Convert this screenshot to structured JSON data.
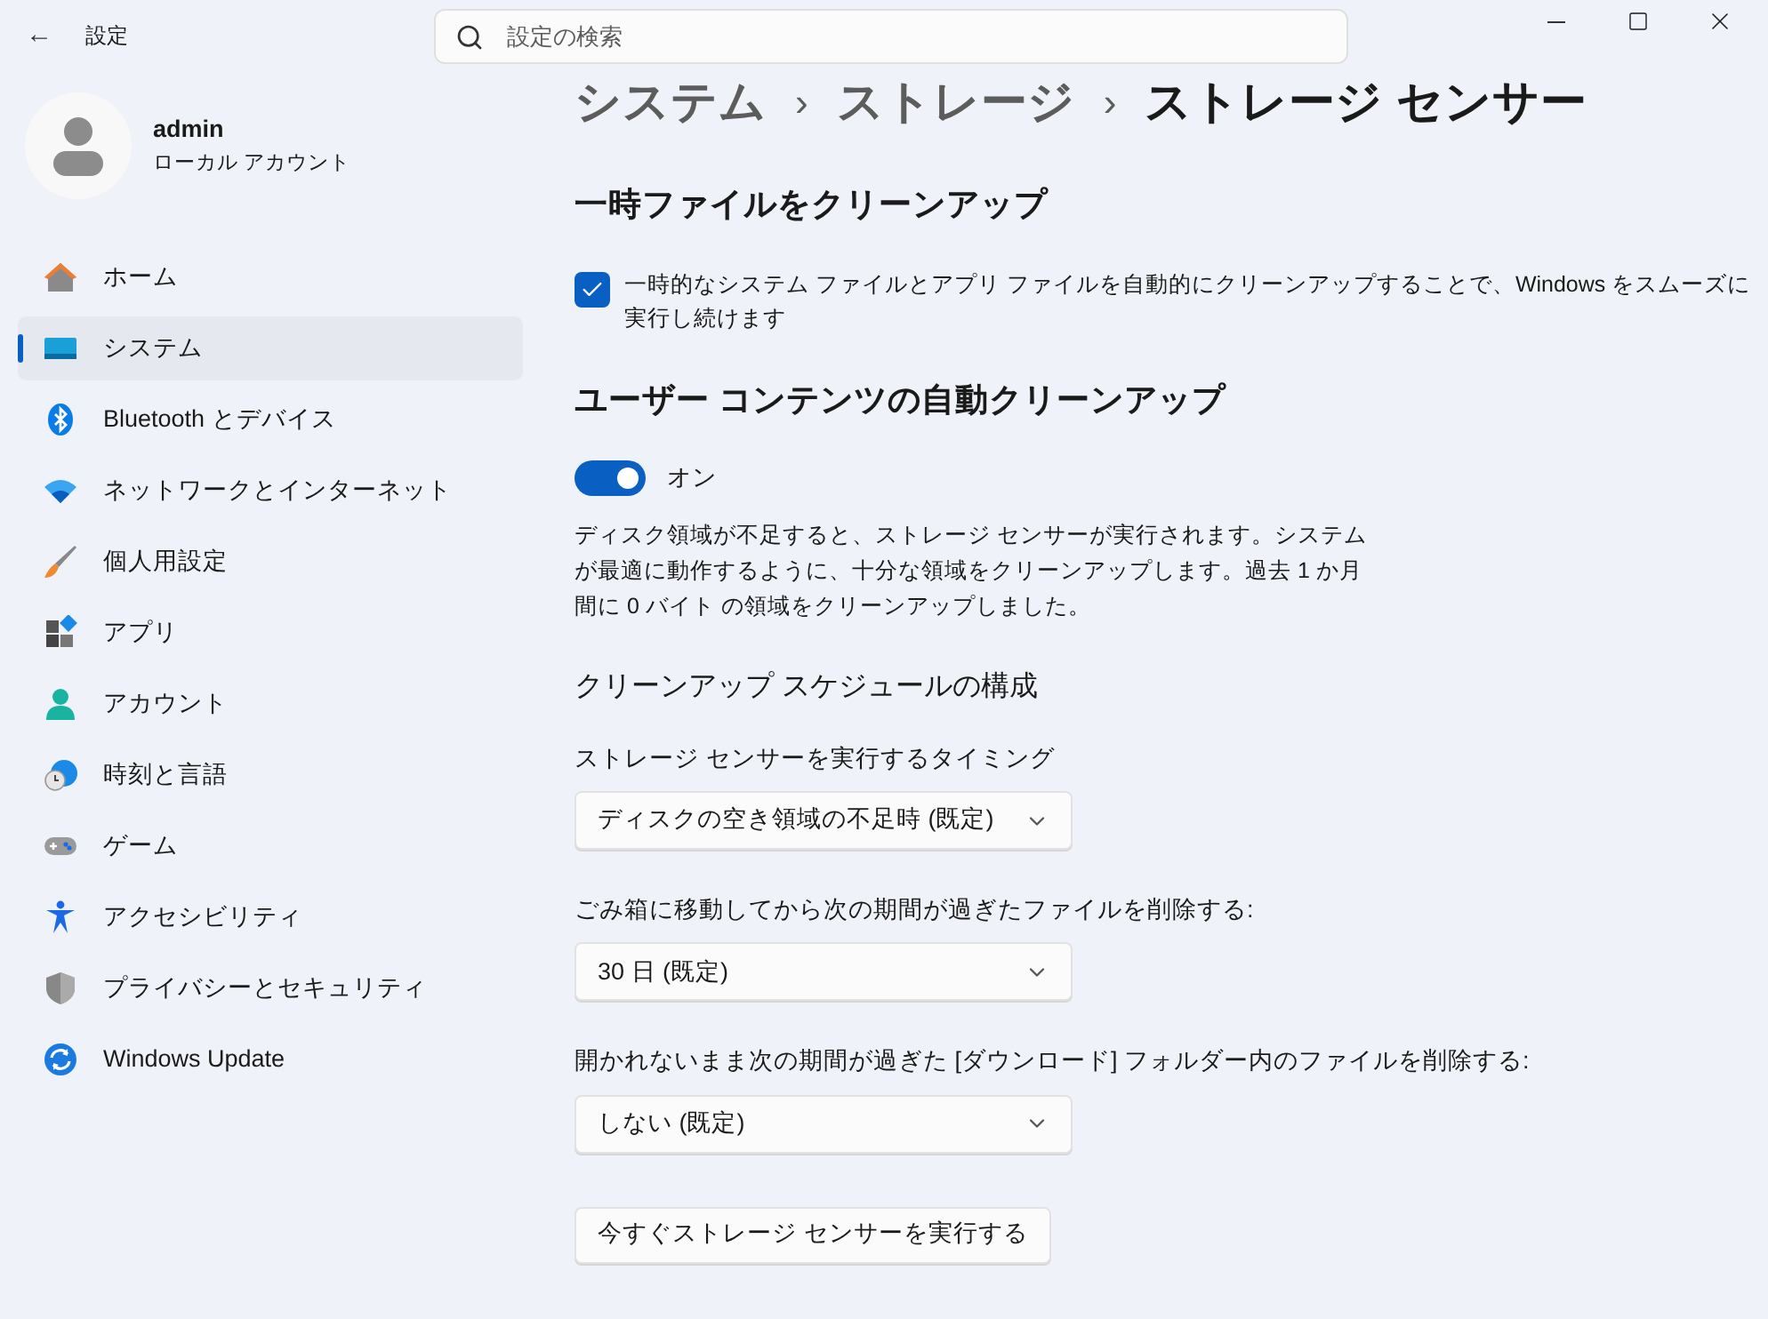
{
  "window": {
    "title": "設定",
    "back": "←"
  },
  "search": {
    "placeholder": "設定の検索"
  },
  "user": {
    "name": "admin",
    "account": "ローカル アカウント"
  },
  "sidebar": {
    "items": [
      {
        "label": "ホーム",
        "selected": false
      },
      {
        "label": "システム",
        "selected": true
      },
      {
        "label": "Bluetooth とデバイス",
        "selected": false
      },
      {
        "label": "ネットワークとインターネット",
        "selected": false
      },
      {
        "label": "個人用設定",
        "selected": false
      },
      {
        "label": "アプリ",
        "selected": false
      },
      {
        "label": "アカウント",
        "selected": false
      },
      {
        "label": "時刻と言語",
        "selected": false
      },
      {
        "label": "ゲーム",
        "selected": false
      },
      {
        "label": "アクセシビリティ",
        "selected": false
      },
      {
        "label": "プライバシーとセキュリティ",
        "selected": false
      },
      {
        "label": "Windows Update",
        "selected": false
      }
    ]
  },
  "breadcrumb": [
    "システム",
    "ストレージ",
    "ストレージ センサー"
  ],
  "breadcrumb_separator": "›",
  "temp_files": {
    "heading": "一時ファイルをクリーンアップ",
    "checkbox": {
      "label": "一時的なシステム ファイルとアプリ ファイルを自動的にクリーンアップすることで、Windows をスムーズに実行し続けます",
      "checked": true
    }
  },
  "auto_cleanup": {
    "heading": "ユーザー コンテンツの自動クリーンアップ",
    "toggle": {
      "on": true,
      "label": "オン"
    },
    "description": "ディスク領域が不足すると、ストレージ センサーが実行されます。システムが最適に動作するように、十分な領域をクリーンアップします。過去 1 か月間に 0 バイト の領域をクリーンアップしました。"
  },
  "schedule": {
    "heading": "クリーンアップ スケジュールの構成",
    "fields": [
      {
        "label": "ストレージ センサーを実行するタイミング",
        "value": "ディスクの空き領域の不足時 (既定)"
      },
      {
        "label": "ごみ箱に移動してから次の期間が過ぎたファイルを削除する:",
        "value": "30 日 (既定)"
      },
      {
        "label": "開かれないまま次の期間が過ぎた [ダウンロード] フォルダー内のファイルを削除する:",
        "value": "しない (既定)"
      }
    ]
  },
  "run_button": "今すぐストレージ センサーを実行する"
}
